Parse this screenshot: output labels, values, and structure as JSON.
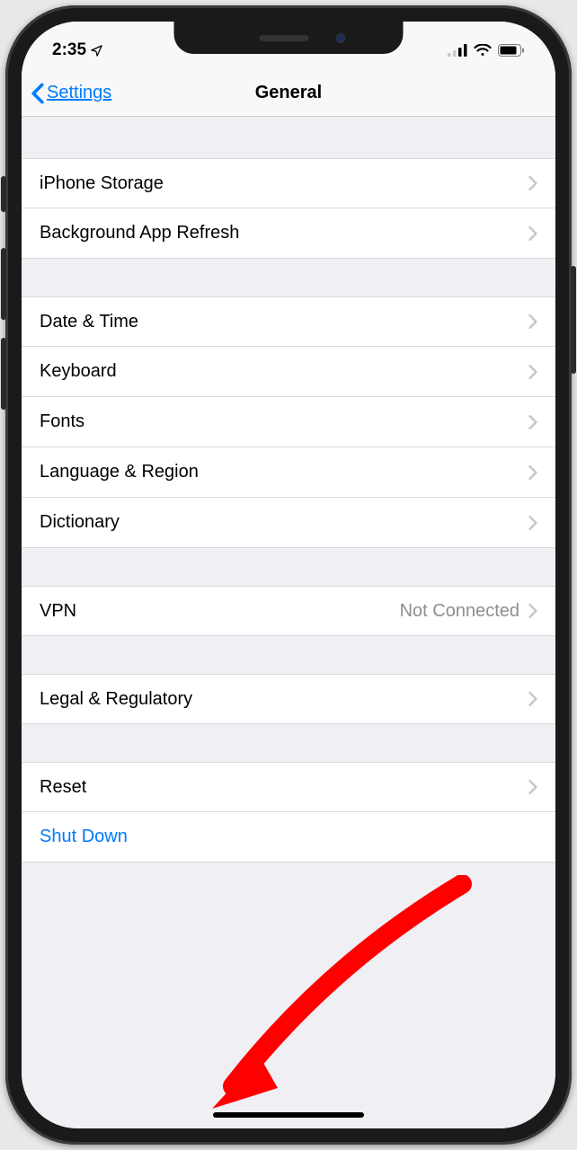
{
  "status": {
    "time": "2:35",
    "location_icon": "location-arrow"
  },
  "nav": {
    "back_label": "Settings",
    "title": "General"
  },
  "groups": [
    {
      "rows": [
        {
          "key": "iphone-storage",
          "label": "iPhone Storage"
        },
        {
          "key": "background-app-refresh",
          "label": "Background App Refresh"
        }
      ]
    },
    {
      "rows": [
        {
          "key": "date-time",
          "label": "Date & Time"
        },
        {
          "key": "keyboard",
          "label": "Keyboard"
        },
        {
          "key": "fonts",
          "label": "Fonts"
        },
        {
          "key": "language-region",
          "label": "Language & Region"
        },
        {
          "key": "dictionary",
          "label": "Dictionary"
        }
      ]
    },
    {
      "rows": [
        {
          "key": "vpn",
          "label": "VPN",
          "detail": "Not Connected"
        }
      ]
    },
    {
      "rows": [
        {
          "key": "legal-regulatory",
          "label": "Legal & Regulatory"
        }
      ]
    },
    {
      "rows": [
        {
          "key": "reset",
          "label": "Reset"
        },
        {
          "key": "shut-down",
          "label": "Shut Down",
          "action": true,
          "no_chevron": true
        }
      ]
    }
  ]
}
